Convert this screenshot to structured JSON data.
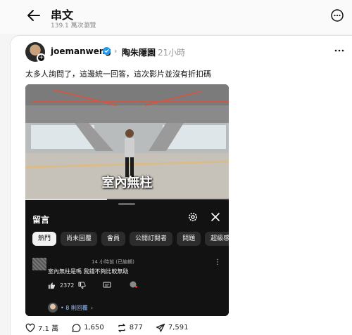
{
  "header": {
    "title": "串文",
    "views": "139.1 萬次瀏覽"
  },
  "post": {
    "username": "joemanweng",
    "partner": "陶朱隱園",
    "time": "21小時",
    "text": "太多人詢問了，這邊統一回答，這次影片並沒有折扣碼"
  },
  "video": {
    "caption": "室內無柱",
    "sheet": {
      "title": "留言",
      "chips": [
        "熱門",
        "尚未回覆",
        "會員",
        "公開訂閱者",
        "問題",
        "超級感"
      ],
      "comment": {
        "time": "14 小時前 (已編輯)",
        "text": "室內無柱是嗎 我錢不夠比較無助",
        "likes": "2372",
        "replies": "• 8 則回覆"
      }
    }
  },
  "stats": {
    "likes": "7.1 萬",
    "comments": "1,650",
    "reposts": "877",
    "shares": "7,591"
  },
  "colors": {
    "verified": "#1d9bf0",
    "replies_link": "#9ec1ff"
  }
}
